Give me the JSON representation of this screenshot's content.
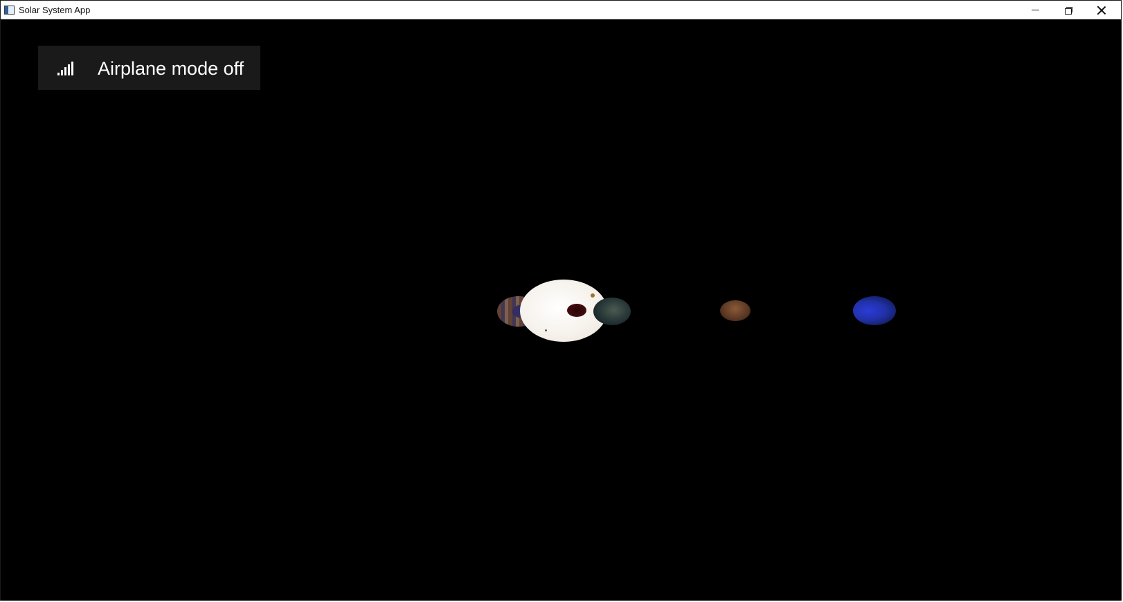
{
  "window": {
    "title": "Solar System App",
    "controls": {
      "minimize_icon": "minimize-icon",
      "maximize_icon": "restore-icon",
      "close_icon": "close-icon"
    }
  },
  "toast": {
    "icon": "signal-bars-icon",
    "text": "Airplane mode off"
  },
  "scene": {
    "background": "#000000",
    "bodies": [
      {
        "name": "planet-left",
        "color": "#4a3c5c"
      },
      {
        "name": "sun",
        "color": "#f6f2ec"
      },
      {
        "name": "earth",
        "color": "#2a3b3a"
      },
      {
        "name": "mars",
        "color": "#5e3a25"
      },
      {
        "name": "neptune",
        "color": "#2131a8"
      }
    ]
  }
}
